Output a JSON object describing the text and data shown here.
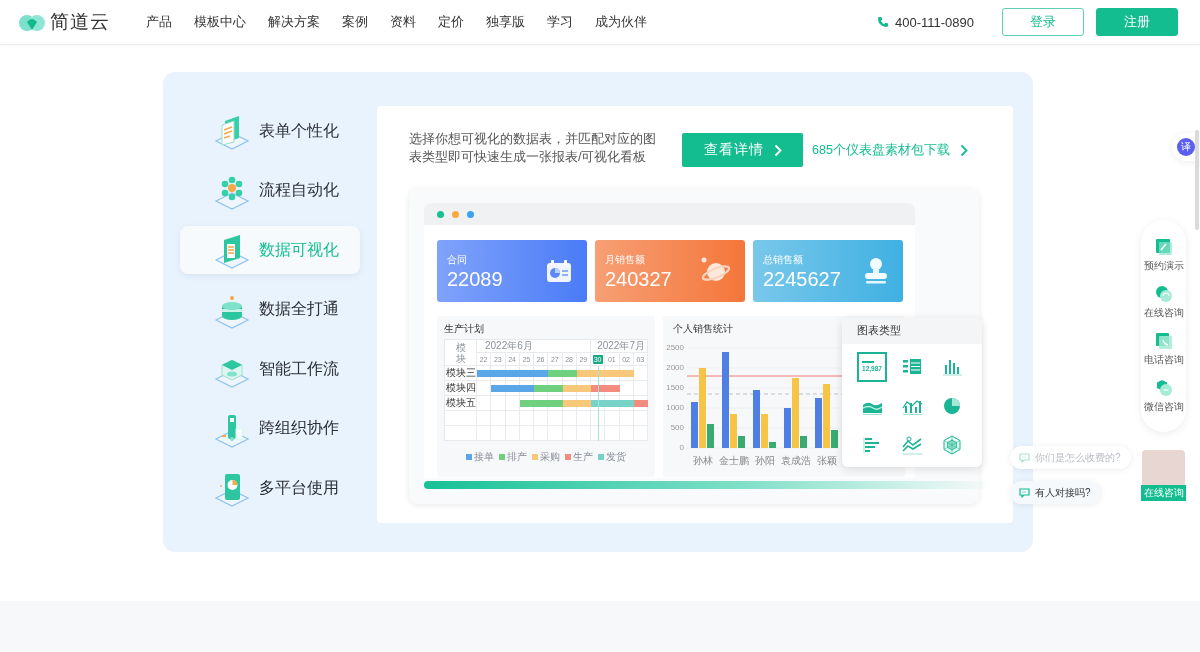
{
  "header": {
    "logo": "简道云",
    "nav": [
      "产品",
      "模板中心",
      "解决方案",
      "案例",
      "资料",
      "定价",
      "独享版",
      "学习",
      "成为伙伴"
    ],
    "phone": "400-111-0890",
    "login": "登录",
    "register": "注册"
  },
  "features": [
    {
      "label": "表单个性化",
      "selected": false
    },
    {
      "label": "流程自动化",
      "selected": false
    },
    {
      "label": "数据可视化",
      "selected": true
    },
    {
      "label": "数据全打通",
      "selected": false
    },
    {
      "label": "智能工作流",
      "selected": false
    },
    {
      "label": "跨组织协作",
      "selected": false
    },
    {
      "label": "多平台使用",
      "selected": false
    }
  ],
  "intro": {
    "text": "选择你想可视化的数据表，并匹配对应的图表类型即可快速生成一张报表/可视化看板",
    "button": "查看详情",
    "link": "685个仪表盘素材包下载"
  },
  "dashboard": {
    "kpis": [
      {
        "label": "合同",
        "value": "22089",
        "color": "#4a7cf8"
      },
      {
        "label": "月销售额",
        "value": "240327",
        "color": "#f4763a"
      },
      {
        "label": "总销售额",
        "value": "2245627",
        "color": "#3fb0e2"
      }
    ],
    "gantt": {
      "title": "生产计划",
      "row_header": "模块",
      "months": [
        "2022年6月",
        "2022年7月"
      ],
      "days": [
        {
          "label": "22",
          "selected": false
        },
        {
          "label": "23",
          "selected": false
        },
        {
          "label": "24",
          "selected": false
        },
        {
          "label": "25",
          "selected": false
        },
        {
          "label": "26",
          "selected": false
        },
        {
          "label": "27",
          "selected": false
        },
        {
          "label": "28",
          "selected": false
        },
        {
          "label": "29",
          "selected": false
        },
        {
          "label": "30",
          "selected": true
        },
        {
          "label": "01",
          "selected": false
        },
        {
          "label": "02",
          "selected": false
        },
        {
          "label": "03",
          "selected": false
        }
      ],
      "rows": [
        "模块三",
        "模块四",
        "模块五"
      ],
      "legend": [
        {
          "label": "接单",
          "color": "#5ba6e8"
        },
        {
          "label": "排产",
          "color": "#6fd07f"
        },
        {
          "label": "采购",
          "color": "#f7c87a"
        },
        {
          "label": "生产",
          "color": "#f38b7f"
        },
        {
          "label": "发货",
          "color": "#77d3c8"
        }
      ]
    },
    "sales": {
      "title": "个人销售统计",
      "chart_data": {
        "type": "bar",
        "categories": [
          "孙林",
          "金士鹏",
          "孙阳",
          "袁成浩",
          "张颖"
        ],
        "series": [
          {
            "color": "#4f7fe2",
            "values": [
              1150,
              2400,
              1450,
              1000,
              1250
            ]
          },
          {
            "color": "#f6c545",
            "values": [
              2000,
              850,
              850,
              1750,
              1600
            ]
          },
          {
            "color": "#3aab70",
            "values": [
              600,
              300,
              150,
              300,
              450
            ]
          }
        ],
        "ylim": [
          0,
          2500
        ],
        "yticks": [
          0,
          500,
          1000,
          1500,
          2000,
          2500
        ],
        "ref_lines": [
          {
            "axis": "y",
            "value": 1800,
            "color": "#f06b6b"
          },
          {
            "axis": "y",
            "value": 1350,
            "color": "#b8bcc4"
          }
        ]
      }
    },
    "chart_picker": {
      "title": "图表类型",
      "types": [
        {
          "selected": true,
          "label": "12,987"
        },
        {
          "selected": false
        },
        {
          "selected": false
        },
        {
          "selected": false
        },
        {
          "selected": false
        },
        {
          "selected": false
        },
        {
          "selected": false
        },
        {
          "selected": false
        },
        {
          "selected": false
        }
      ]
    }
  },
  "translate": "译",
  "float_bar": [
    "预约演示",
    "在线咨询",
    "电话咨询",
    "微信咨询"
  ],
  "chat": {
    "questions": [
      {
        "text": "你们是怎么收费的?",
        "faded": true
      },
      {
        "text": "有人对接吗?",
        "faded": false
      }
    ],
    "agent_button": "在线咨询"
  }
}
